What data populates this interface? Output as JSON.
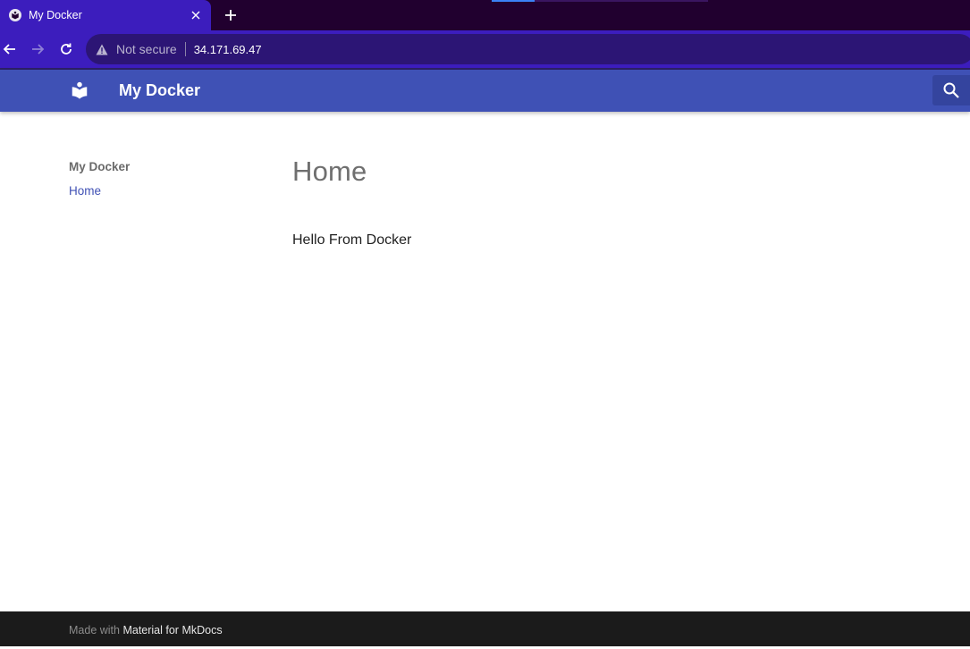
{
  "browser": {
    "tab": {
      "title": "My Docker",
      "favicon": "mkdocs-book-icon"
    },
    "omnibox": {
      "security_status": "Not secure",
      "url": "34.171.69.47"
    },
    "icons": {
      "back": "arrow-left-icon",
      "forward": "arrow-right-icon",
      "reload": "reload-icon",
      "warning": "warning-triangle-icon",
      "new_tab": "plus-icon",
      "close": "close-icon"
    }
  },
  "header": {
    "title": "My Docker",
    "logo": "book-reader-icon",
    "search_icon": "search-icon"
  },
  "sidebar": {
    "title": "My Docker",
    "items": [
      {
        "label": "Home",
        "active": true
      }
    ]
  },
  "content": {
    "title": "Home",
    "paragraph": "Hello From Docker"
  },
  "footer": {
    "prefix": "Made with ",
    "link_text": "Material for MkDocs"
  },
  "colors": {
    "chrome": "#3c1dbd",
    "tabbar": "#21002f",
    "primary": "#3f51b5",
    "footer": "#1b1b1b",
    "link": "#4051b5"
  }
}
